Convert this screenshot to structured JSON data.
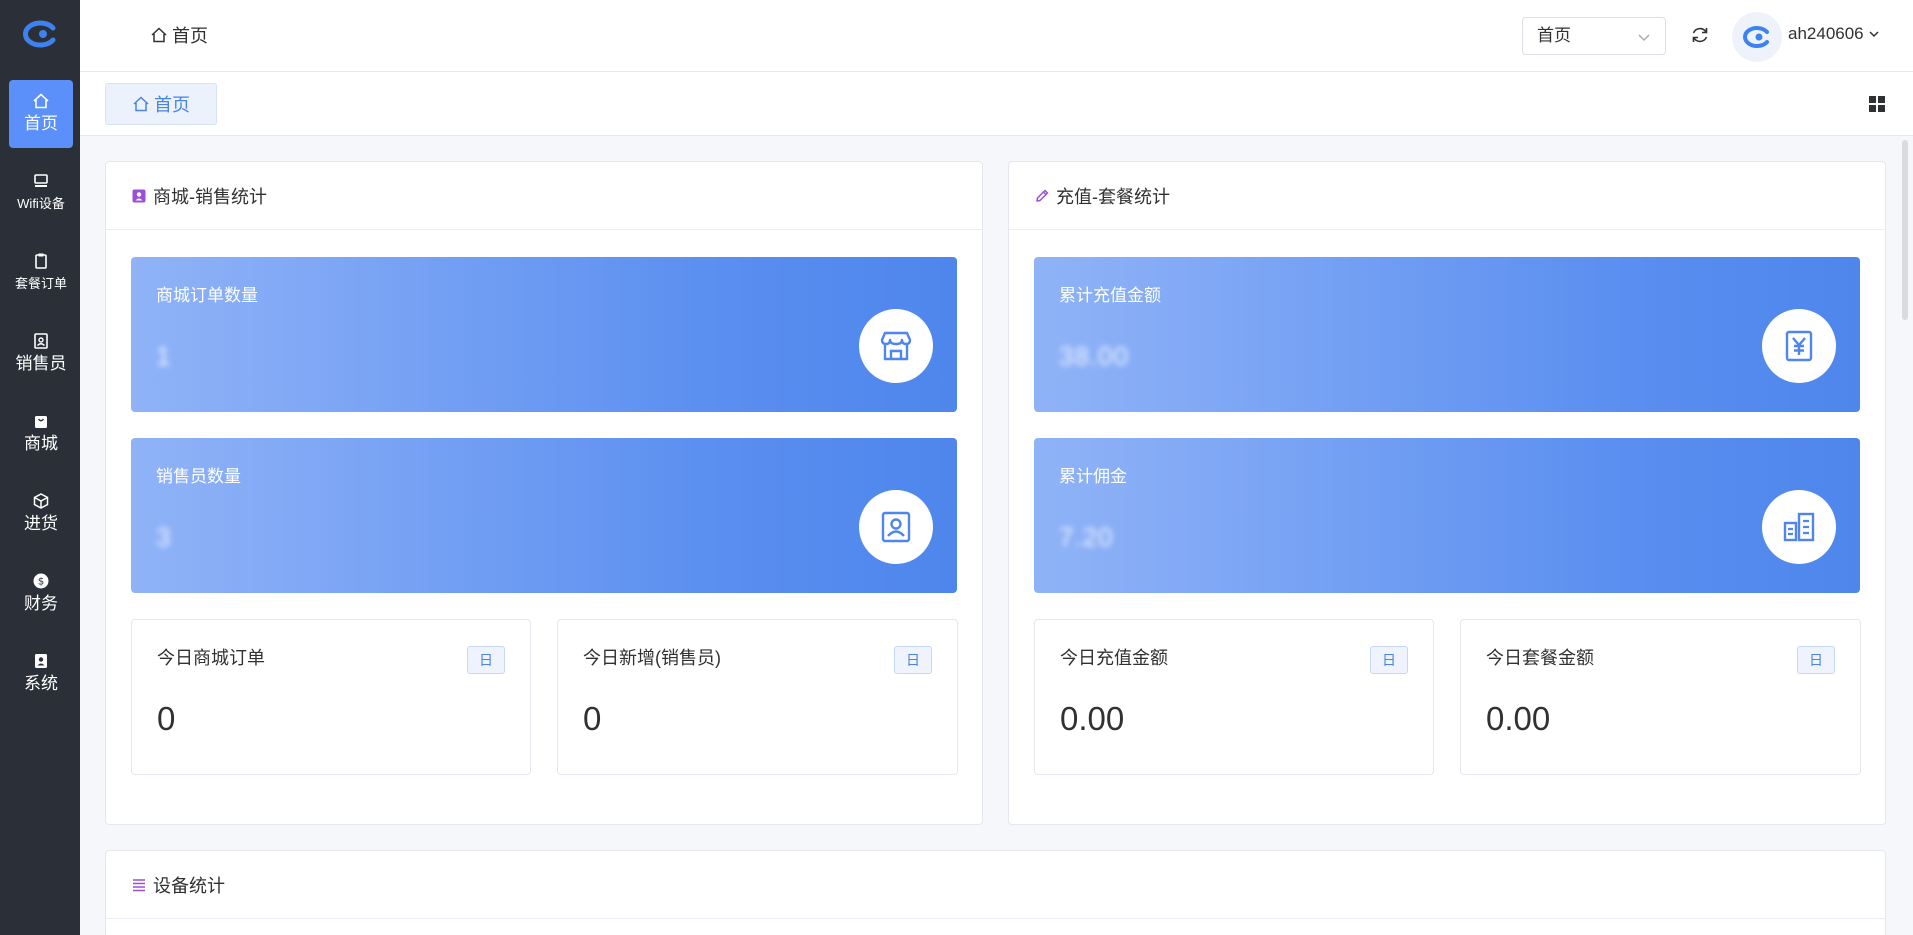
{
  "sidebar": {
    "items": [
      {
        "label": "首页",
        "icon": "home-icon",
        "active": true
      },
      {
        "label": "Wifi设备",
        "icon": "monitor-icon"
      },
      {
        "label": "套餐订单",
        "icon": "clipboard-icon"
      },
      {
        "label": "销售员",
        "icon": "id-card-icon"
      },
      {
        "label": "商城",
        "icon": "bag-icon"
      },
      {
        "label": "进货",
        "icon": "box-icon"
      },
      {
        "label": "财务",
        "icon": "coin-icon"
      },
      {
        "label": "系统",
        "icon": "user-badge-icon"
      }
    ]
  },
  "header": {
    "breadcrumb": "首页",
    "select_value": "首页",
    "username": "ah240606"
  },
  "tabs": [
    {
      "label": "首页"
    }
  ],
  "mall_panel": {
    "title": "商城-销售统计",
    "cards": [
      {
        "title": "商城订单数量",
        "value": "1",
        "icon": "store-icon"
      },
      {
        "title": "销售员数量",
        "value": "3",
        "icon": "contact-icon"
      }
    ],
    "stats": [
      {
        "title": "今日商城订单",
        "badge": "日",
        "value": "0"
      },
      {
        "title": "今日新增(销售员)",
        "badge": "日",
        "value": "0"
      }
    ]
  },
  "recharge_panel": {
    "title": "充值-套餐统计",
    "cards": [
      {
        "title": "累计充值金额",
        "value": "38.00",
        "icon": "yen-icon"
      },
      {
        "title": "累计佣金",
        "value": "7.20",
        "icon": "building-icon"
      }
    ],
    "stats": [
      {
        "title": "今日充值金额",
        "badge": "日",
        "value": "0.00"
      },
      {
        "title": "今日套餐金额",
        "badge": "日",
        "value": "0.00"
      }
    ]
  },
  "device_panel": {
    "title": "设备统计"
  },
  "colors": {
    "accent": "#5b8ff9",
    "sidebar": "#2b3038",
    "purple": "#9b4fd6"
  }
}
